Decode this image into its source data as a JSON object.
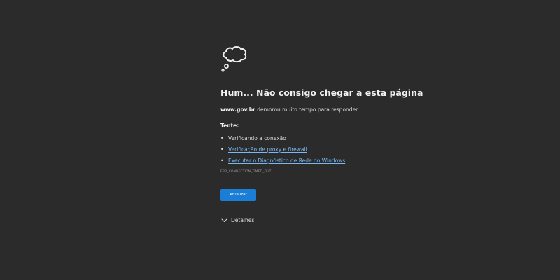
{
  "error_page": {
    "icon": "thought-cloud-icon",
    "heading": "Hum... Não consigo chegar a esta página",
    "domain": "www.gov.br",
    "domain_message": " demorou muito tempo para responder",
    "try_label": "Tente:",
    "suggestions": [
      {
        "text": "Verificando a conexão",
        "is_link": false
      },
      {
        "text": "Verificação de proxy e firewall",
        "is_link": true
      },
      {
        "text": "Executar o Diagnóstico de Rede do Windows",
        "is_link": true
      }
    ],
    "bullet": "•",
    "error_code": "ERR_CONNECTION_TIMED_OUT",
    "refresh_button": "Atualizar",
    "details_label": "Detalhes",
    "details_icon": "chevron-down-icon"
  },
  "colors": {
    "background": "#2b2b2b",
    "text": "#e6e6e6",
    "link": "#79b8f3",
    "button": "#1a7ed6",
    "error_code": "#9a9a9a"
  }
}
